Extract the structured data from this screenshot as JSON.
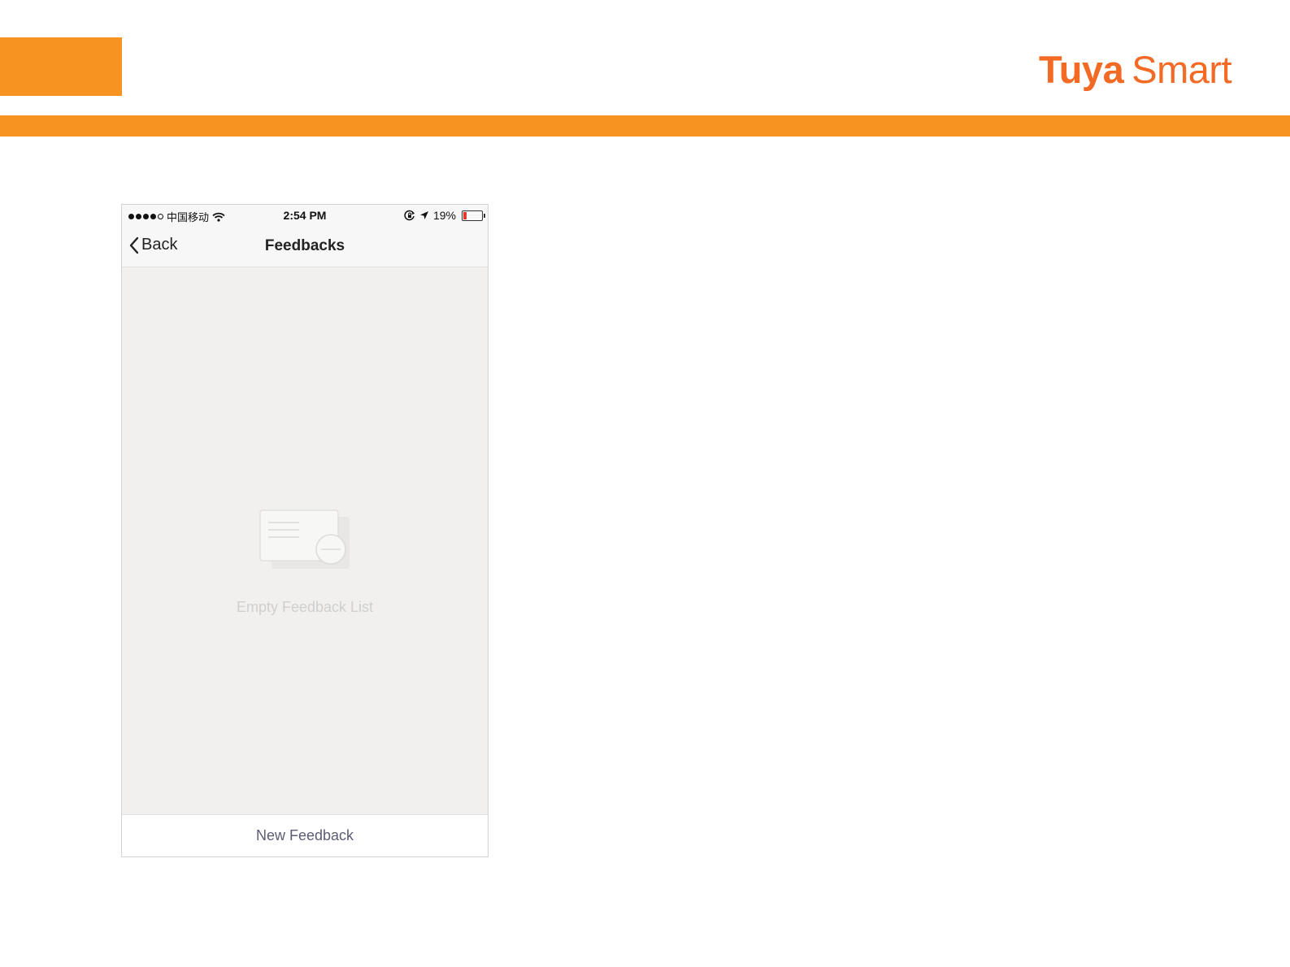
{
  "colors": {
    "brand_orange": "#f79421",
    "logo_orange": "#f26a24",
    "battery_low": "#e03a2b"
  },
  "brand": {
    "bold_text": "Tuya",
    "light_text": "Smart"
  },
  "status_bar": {
    "carrier": "中国移动",
    "time": "2:54 PM",
    "battery_text": "19%",
    "battery_level": 0.19,
    "icons": [
      "signal-dots-icon",
      "wifi-icon",
      "rotation-lock-icon",
      "location-arrow-icon",
      "battery-icon"
    ]
  },
  "nav": {
    "back_label": "Back",
    "title": "Feedbacks"
  },
  "empty_state": {
    "icon": "empty-feedback-card-icon",
    "message": "Empty Feedback List"
  },
  "footer": {
    "new_feedback_label": "New Feedback"
  }
}
